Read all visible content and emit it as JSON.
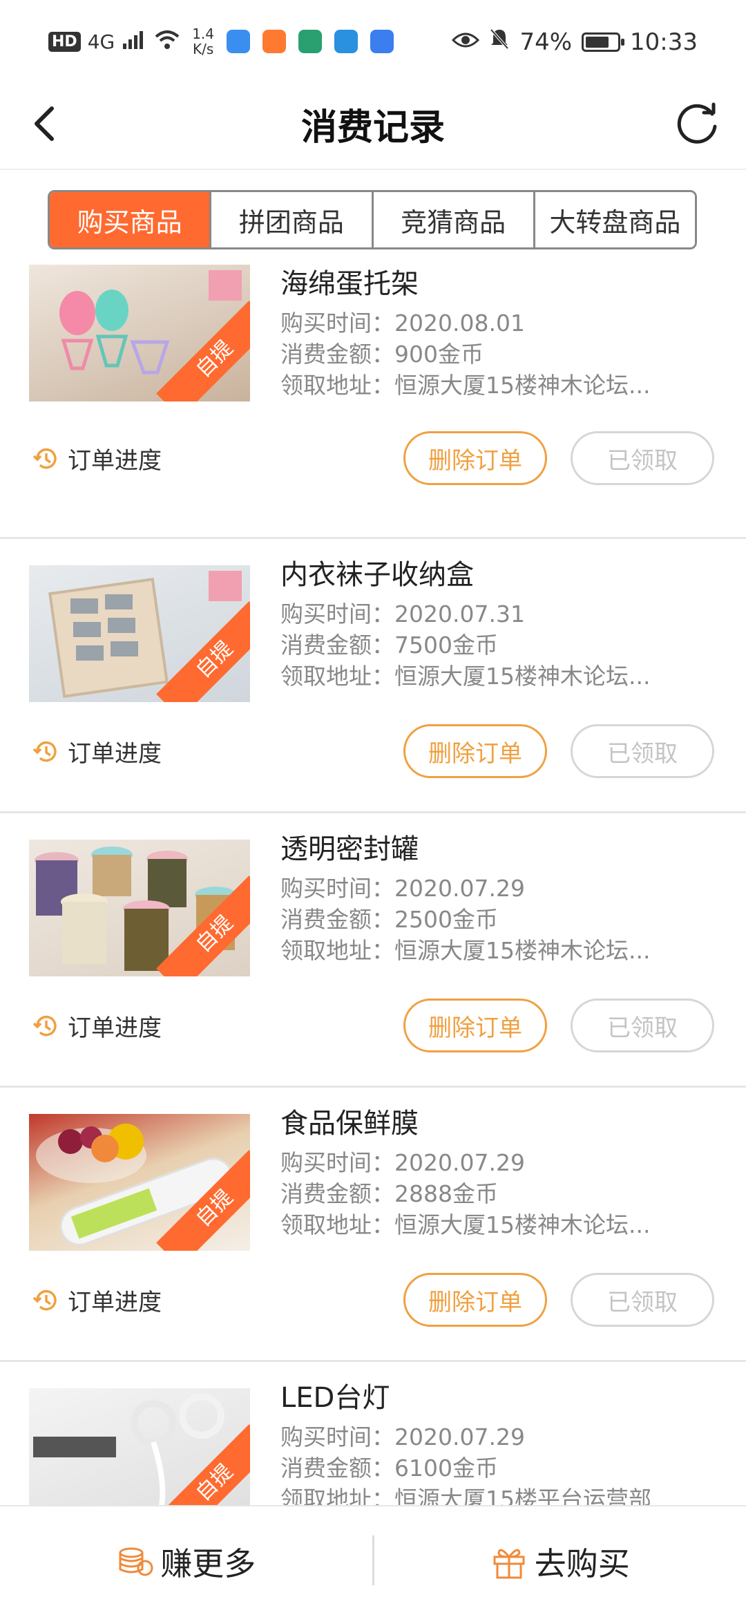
{
  "status_bar": {
    "hd": "HD",
    "network": "4G",
    "speed_value": "1.4",
    "speed_unit": "K/s",
    "battery": "74%",
    "time": "10:33"
  },
  "header": {
    "title": "消费记录"
  },
  "tabs": [
    {
      "label": "购买商品",
      "active": true
    },
    {
      "label": "拼团商品",
      "active": false
    },
    {
      "label": "竞猜商品",
      "active": false
    },
    {
      "label": "大转盘商品",
      "active": false
    }
  ],
  "labels": {
    "purchase_time": "购买时间：",
    "amount": "消费金额：",
    "address": "领取地址：",
    "order_progress": "订单进度",
    "delete_order": "删除订单",
    "received": "已领取",
    "pickup_tag": "自提"
  },
  "orders": [
    {
      "name": "海绵蛋托架",
      "time": "2020.08.01",
      "amount": "900金币",
      "address": "恒源大厦15楼神木论坛..."
    },
    {
      "name": "内衣袜子收纳盒",
      "time": "2020.07.31",
      "amount": "7500金币",
      "address": "恒源大厦15楼神木论坛..."
    },
    {
      "name": "透明密封罐",
      "time": "2020.07.29",
      "amount": "2500金币",
      "address": "恒源大厦15楼神木论坛..."
    },
    {
      "name": "食品保鲜膜",
      "time": "2020.07.29",
      "amount": "2888金币",
      "address": "恒源大厦15楼神木论坛..."
    },
    {
      "name": "LED台灯",
      "time": "2020.07.29",
      "amount": "6100金币",
      "address": "恒源大厦15楼平台运营部"
    }
  ],
  "bottom_bar": {
    "earn_more": "赚更多",
    "go_buy": "去购买"
  },
  "colors": {
    "accent": "#ff6a30",
    "button_orange": "#f0a040",
    "disabled": "#c4c4c4"
  }
}
